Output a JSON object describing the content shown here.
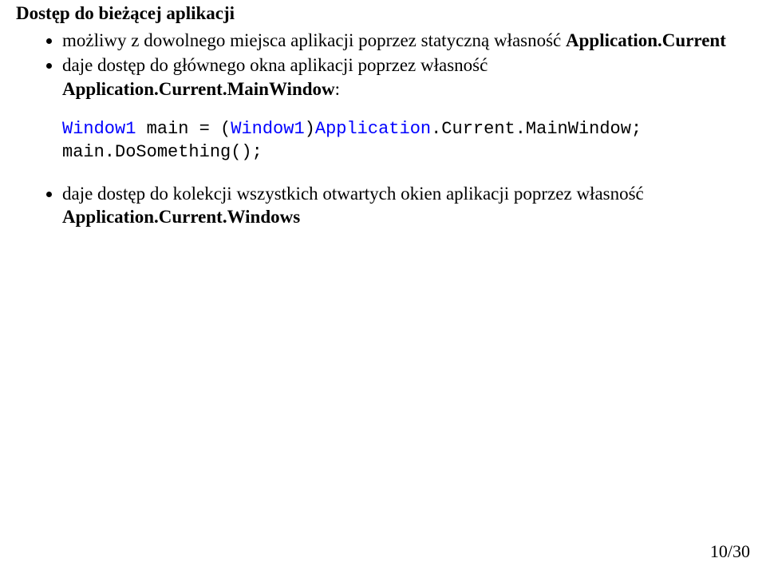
{
  "title": "Dostęp do bieżącej aplikacji",
  "bullets": {
    "b1_pre": "możliwy z dowolnego miejsca aplikacji poprzez statyczną własność ",
    "b1_bold": "Application.Current",
    "b2_pre": "daje dostęp do głównego okna aplikacji poprzez własność ",
    "b2_bold": "Application.Current.MainWindow",
    "b2_post": ":",
    "b3_pre": "daje dostęp do kolekcji wszystkich otwartych okien aplikacji poprzez własność ",
    "b3_bold": "Application.Current.Windows"
  },
  "code": {
    "t1": "Window1",
    "t2": " main = (",
    "t3": "Window1",
    "t4": ")",
    "t5": "Application",
    "t6": ".Current.MainWindow;",
    "t7": "main.DoSomething();"
  },
  "pagenum": "10/30"
}
